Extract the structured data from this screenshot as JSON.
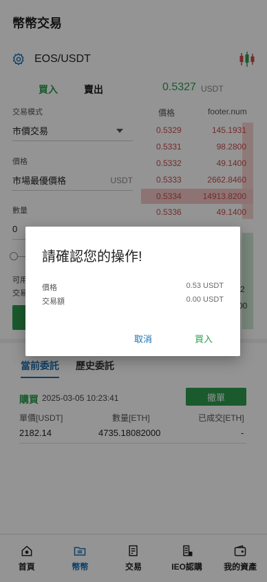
{
  "header": {
    "title": "幣幣交易",
    "pair": "EOS/USDT"
  },
  "trade_tabs": {
    "buy": "買入",
    "sell": "賣出"
  },
  "last_price": {
    "value": "0.5327",
    "unit": "USDT"
  },
  "form": {
    "trade_mode_label": "交易模式",
    "trade_mode_value": "市價交易",
    "price_label": "價格",
    "price_value": "市場最優價格",
    "price_unit": "USDT",
    "amount_label": "數量",
    "amount_value": "0",
    "available_partial": "可用",
    "volume_partial": "交易"
  },
  "order_book": {
    "col_price": "價格",
    "col_amount": "footer.num",
    "rows": [
      {
        "price": "0.5329",
        "amount": "145.1931"
      },
      {
        "price": "0.5331",
        "amount": "98.2800"
      },
      {
        "price": "0.5332",
        "amount": "49.1400"
      },
      {
        "price": "0.5333",
        "amount": "2662.8460"
      },
      {
        "price": "0.5334",
        "amount": "14913.8200"
      },
      {
        "price": "0.5336",
        "amount": "49.1400"
      }
    ],
    "partial_right": [
      "2",
      "00"
    ]
  },
  "orders": {
    "tab_current": "當前委託",
    "tab_history": "歷史委託",
    "side": "購買",
    "time": "2025-03-05 10:23:41",
    "cancel_label": "撤單",
    "col_price": "單價[USDT]",
    "col_amount": "數量[ETH]",
    "col_filled": "已成交[ETH]",
    "price": "2182.14",
    "amount": "4735.18082000",
    "filled": "-"
  },
  "nav": {
    "home": "首頁",
    "coin": "幣幣",
    "trade": "交易",
    "ieo": "IEO認購",
    "assets": "我的資產"
  },
  "dialog": {
    "title": "請確認您的操作!",
    "price_label": "價格",
    "price_value": "0.53 USDT",
    "volume_label": "交易額",
    "volume_value": "0.00 USDT",
    "cancel": "取消",
    "confirm": "買入"
  },
  "colors": {
    "green": "#2e9b4e",
    "red": "#c94a4a",
    "blue": "#1a6fb0"
  }
}
